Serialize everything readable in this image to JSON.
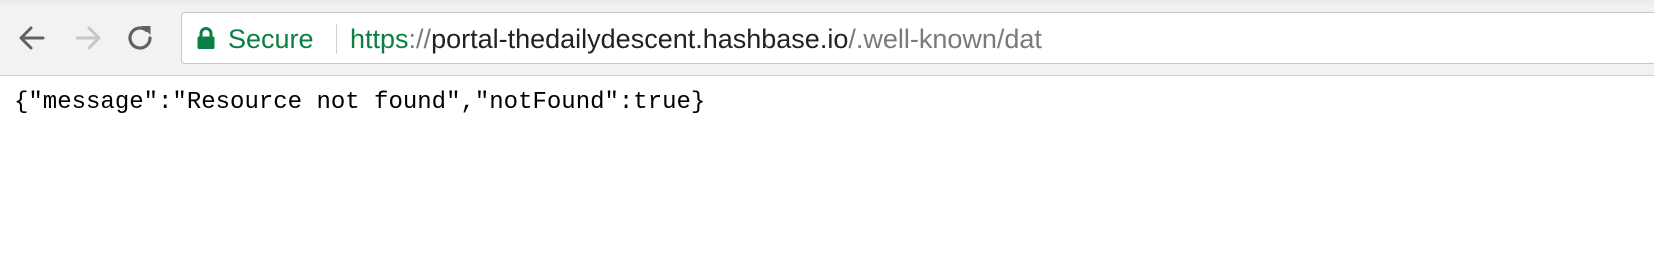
{
  "browser": {
    "nav": {
      "back_icon": "arrow-left-icon",
      "forward_icon": "arrow-right-icon",
      "reload_icon": "reload-icon"
    },
    "omnibox": {
      "lock_icon": "lock-icon",
      "security_label": "Secure",
      "url_scheme": "https",
      "url_separator": "://",
      "url_host": "portal-thedailydescent.hashbase.io",
      "url_path": "/.well-known/dat"
    },
    "colors": {
      "secure_green": "#0b8043",
      "host_text": "#222222",
      "dim_text": "#7a7a7a"
    }
  },
  "page": {
    "body_text": "{\"message\":\"Resource not found\",\"notFound\":true}"
  }
}
